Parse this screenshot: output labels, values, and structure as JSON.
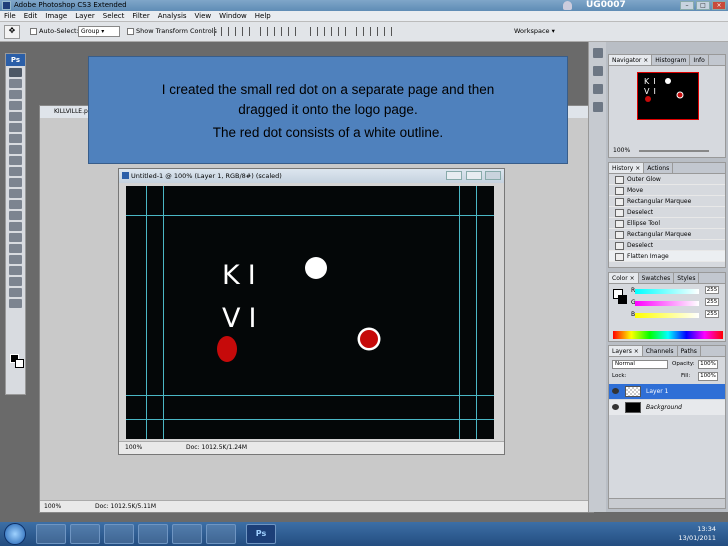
{
  "app": {
    "title": "Adobe Photoshop CS3 Extended",
    "user": "UG0007"
  },
  "menu": [
    "File",
    "Edit",
    "Image",
    "Layer",
    "Select",
    "Filter",
    "Analysis",
    "View",
    "Window",
    "Help"
  ],
  "options": {
    "auto_select": "Auto-Select:",
    "group": "Group",
    "transform": "Show Transform Controls",
    "workspace": "Workspace ▾"
  },
  "toolbox": {
    "badge": "Ps"
  },
  "document": {
    "title": "KILLVILLE.p",
    "zoom": "100%",
    "doc": "Doc: 1012.5K/5.11M"
  },
  "subwindow": {
    "title": "Untitled-1 @ 100% (Layer 1, RGB/8#) (scaled)",
    "zoom": "100%",
    "doc": "Doc: 1012.5K/1.24M",
    "text_line1": "KI",
    "text_line2": "VI"
  },
  "callout": {
    "line1": "I created the small red dot on a separate page and then",
    "line2": "dragged it onto the logo page.",
    "line3": "The red dot consists of a white outline."
  },
  "navigator": {
    "tabs": [
      "Navigator ×",
      "Histogram",
      "Info"
    ],
    "zoom": "100%",
    "thumb_line1": "KI",
    "thumb_line2": "VI"
  },
  "history": {
    "tabs": [
      "History ×",
      "Actions"
    ],
    "items": [
      "Outer Glow",
      "Move",
      "Rectangular Marquee",
      "Deselect",
      "Ellipse Tool",
      "Rectangular Marquee",
      "Deselect",
      "Flatten Image"
    ]
  },
  "color": {
    "tabs": [
      "Color ×",
      "Swatches",
      "Styles"
    ],
    "channels": [
      {
        "name": "R",
        "value": "255"
      },
      {
        "name": "G",
        "value": "255"
      },
      {
        "name": "B",
        "value": "255"
      }
    ]
  },
  "layers": {
    "tabs": [
      "Layers ×",
      "Channels",
      "Paths"
    ],
    "blend": "Normal",
    "opacity_label": "Opacity:",
    "opacity": "100%",
    "lock_label": "Lock:",
    "fill_label": "Fill:",
    "fill": "100%",
    "rows": [
      {
        "name": "Layer 1"
      },
      {
        "name": "Background"
      }
    ]
  },
  "taskbar": {
    "ps": "Ps",
    "time": "13:34",
    "date": "13/01/2011"
  }
}
